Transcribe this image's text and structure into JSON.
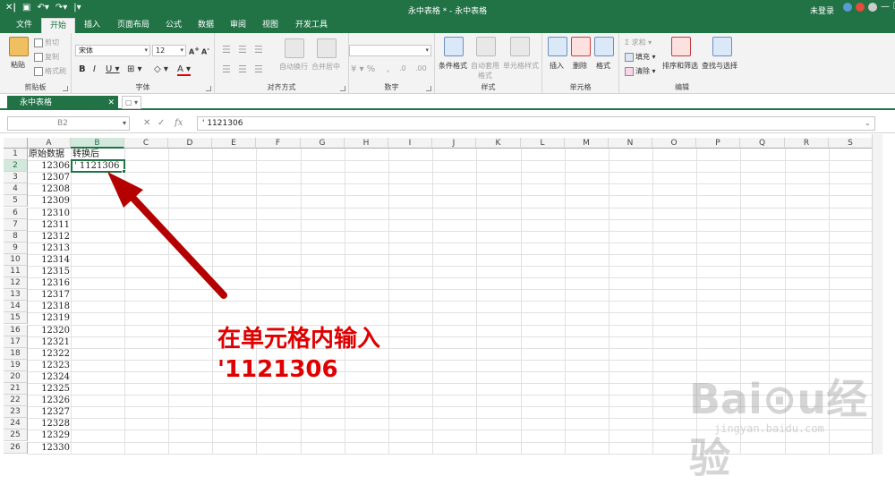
{
  "window": {
    "title": "永中表格 * - 永中表格",
    "login": "未登录"
  },
  "tabs": [
    "文件",
    "开始",
    "插入",
    "页面布局",
    "公式",
    "数据",
    "审阅",
    "视图",
    "开发工具"
  ],
  "ribbon": {
    "clipboard": {
      "label": "剪贴板",
      "paste": "粘贴",
      "cut": "剪切",
      "copy": "复制",
      "format_painter": "格式刷"
    },
    "font": {
      "label": "字体",
      "font_name": "宋体",
      "font_size": "12"
    },
    "alignment": {
      "label": "对齐方式",
      "wrap": "自动换行",
      "merge": "合并居中"
    },
    "number": {
      "label": "数字",
      "format": ""
    },
    "styles": {
      "label": "样式",
      "conditional": "条件格式",
      "table_style_1": "自动套用",
      "table_style_2": "格式",
      "cell_style": "单元格样式"
    },
    "cells": {
      "label": "单元格",
      "insert": "插入",
      "delete": "删除",
      "format": "格式"
    },
    "editing": {
      "label": "编辑",
      "sum": "求和",
      "fill": "填充",
      "clear": "清除",
      "sort": "排序和筛选",
      "find": "查找与选择"
    }
  },
  "doc_tab": "永中表格",
  "formula_bar": {
    "cell_ref": "B2",
    "fx": "fx",
    "content": "' 1121306"
  },
  "columns": [
    "A",
    "B",
    "C",
    "D",
    "E",
    "F",
    "G",
    "H",
    "I",
    "J",
    "K",
    "L",
    "M",
    "N",
    "O",
    "P",
    "Q",
    "R",
    "S"
  ],
  "rows": [
    "1",
    "2",
    "3",
    "4",
    "5",
    "6",
    "7",
    "8",
    "9",
    "10",
    "11",
    "12",
    "13",
    "14",
    "15",
    "16",
    "17",
    "18",
    "19",
    "20",
    "21",
    "22",
    "23",
    "24",
    "25",
    "26"
  ],
  "cells": {
    "A1": "原始数据",
    "B1": "转换后",
    "B2": "' 1121306",
    "a_values": [
      "12306",
      "12307",
      "12308",
      "12309",
      "12310",
      "12311",
      "12312",
      "12313",
      "12314",
      "12315",
      "12316",
      "12317",
      "12318",
      "12319",
      "12320",
      "12321",
      "12322",
      "12323",
      "12324",
      "12325",
      "12326",
      "12327",
      "12328",
      "12329",
      "12330"
    ]
  },
  "annotation": {
    "line1": "在单元格内输入",
    "line2": "'1121306"
  },
  "watermark": {
    "brand": "Bai⊙u经验",
    "url": "jingyan.baidu.com"
  },
  "colors": {
    "accent": "#217346",
    "annotation": "#e00000"
  }
}
